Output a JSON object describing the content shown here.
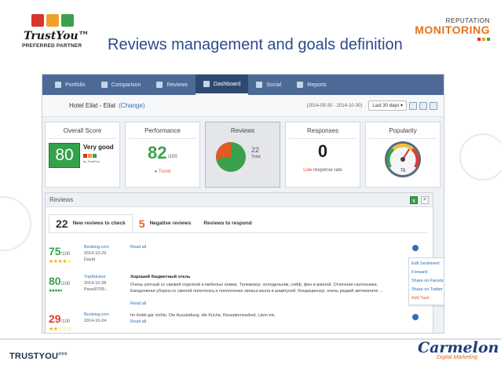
{
  "branding": {
    "trustyou_logo": "TrustYou™",
    "trustyou_partner": "PREFERRED PARTNER",
    "rm_small": "REPUTATION",
    "rm_big": "MONITORING",
    "footer_trustyou": "TRUSTYOU",
    "footer_trustyou_sup": "®®®",
    "carmelon": "Carmelon",
    "carmelon_sub": "Digital Marketing",
    "colors": {
      "flag_red": "#d9352b",
      "flag_orange": "#f0a02a",
      "flag_green": "#3aa14c",
      "accent_orange": "#e8731a",
      "title_blue": "#2d4a8f"
    }
  },
  "slide": {
    "title": "Reviews management and goals definition"
  },
  "nav": {
    "tabs": [
      {
        "label": "Portfolio",
        "icon": "portfolio-icon"
      },
      {
        "label": "Comparison",
        "icon": "comparison-arrows-icon"
      },
      {
        "label": "Reviews",
        "icon": "reviews-chat-icon"
      },
      {
        "label": "Dashboard",
        "icon": "dashboard-gauge-icon",
        "active": true
      },
      {
        "label": "Social",
        "icon": "social-icon"
      },
      {
        "label": "Reports",
        "icon": "reports-bars-icon"
      }
    ]
  },
  "hotel": {
    "name": "Hotel Eilat - Eilat",
    "change_label": "(Change)",
    "date_range": "(2014-09-30 - 2014-10-30)",
    "period": "Last 30 days ▾"
  },
  "cards": {
    "overall": {
      "title": "Overall Score",
      "score": "80",
      "verdict": "Very good",
      "brand": "by TrustYou"
    },
    "performance": {
      "title": "Performance",
      "value": "82",
      "denominator": "/100",
      "trend": "Trend"
    },
    "reviews": {
      "title": "Reviews",
      "count": "22",
      "total_label": "Total",
      "pie_share_orange": 0.27
    },
    "responses": {
      "title": "Responses",
      "value": "0",
      "low_label": "Low",
      "rate_label": "response rate"
    },
    "popularity": {
      "title": "Popularity",
      "gauge_value": "76"
    }
  },
  "reviews_panel": {
    "title": "Reviews",
    "tabs": [
      {
        "count": "22",
        "label": "New reviews to check"
      },
      {
        "count": "5",
        "label": "Negative reviews"
      },
      {
        "count": "",
        "label": "Reviews to respond"
      }
    ],
    "items": [
      {
        "score": "75",
        "den": "/100",
        "stars": "★★★★☆",
        "source": "Booking.com",
        "date": "2014-10-29",
        "author": "David",
        "title": "",
        "text": "",
        "read_all": "Read all",
        "score_color": "#38a349"
      },
      {
        "score": "80",
        "den": "/100",
        "stars": "●●●●◐",
        "source": "TripAdvisor",
        "date": "2014-10-28",
        "author": "Pavel0709...",
        "title": "Хороший бюджетный отель",
        "text": "Очень уютный со свежей отделкой и мебелью номер. Телевизор, холодильник, сейф, фен в ванной. Отличная сантехника. Ежедневная уборка со сменой полотенец и пополнение запаса мыла и шампуней. Кондиционер, очень редкий автоматиче ...",
        "read_all": "Read all",
        "score_color": "#38a349"
      },
      {
        "score": "29",
        "den": "/100",
        "stars": "★★☆☆☆",
        "source": "Booking.com",
        "date": "2014-10-24",
        "author": "",
        "title": "",
        "text": "Im Hotel gar nichts. Die Ausstattung, die Küche, Rezeptionsarbeit, Lärm etc.",
        "read_all": "Read all",
        "score_color": "#e03a2f"
      }
    ],
    "context_menu": [
      "Edit Sentiment",
      "Forward",
      "Share on Facebook",
      "Share on Twitter",
      "Add Task"
    ]
  }
}
